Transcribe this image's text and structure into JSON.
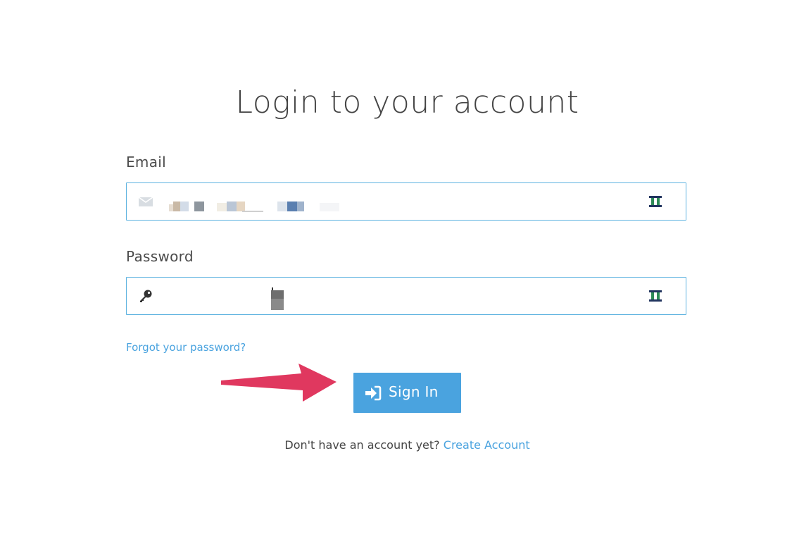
{
  "page": {
    "title": "Login to your account"
  },
  "form": {
    "email_label": "Email",
    "password_label": "Password",
    "forgot_password": "Forgot your password?",
    "submit_label": "Sign In"
  },
  "footer": {
    "prompt": "Don't have an account yet?",
    "create_account": "Create Account"
  },
  "icons": {
    "email_field": "envelope-icon",
    "password_field": "key-icon",
    "password_manager": "password-manager-icon",
    "submit": "sign-in-icon",
    "annotation": "arrow-annotation"
  },
  "colors": {
    "accent": "#4aa3df",
    "field_border": "#5fb3e0",
    "annotation_arrow": "#e0385f",
    "text": "#444444"
  }
}
